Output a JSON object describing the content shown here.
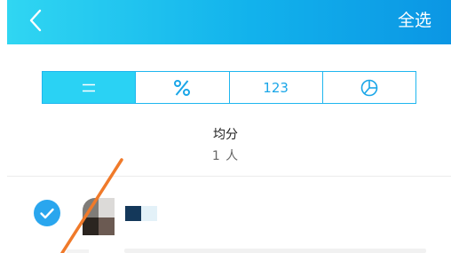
{
  "header": {
    "back_icon": "chevron-left-icon",
    "select_all_label": "全选",
    "background": [
      "#30d6f2",
      "#0b96e4"
    ]
  },
  "split_tabs": {
    "items": [
      {
        "icon": "equal-icon",
        "label": "",
        "active": true
      },
      {
        "icon": "percent-icon",
        "label": "",
        "active": false
      },
      {
        "icon": "",
        "label": "123",
        "active": false
      },
      {
        "icon": "pie-chart-icon",
        "label": "",
        "active": false
      }
    ],
    "accent_color": "#1fb6ef",
    "active_color": "#2ad2f4"
  },
  "summary": {
    "mode_label": "均分",
    "count_label": "1 人"
  },
  "members": [
    {
      "checked": true,
      "check_color": "#2aa6ee",
      "avatar": "pixelated-avatar",
      "name": "pixelated-name"
    }
  ],
  "annotation": {
    "type": "orange-arrow",
    "color": "#f07a2a"
  }
}
